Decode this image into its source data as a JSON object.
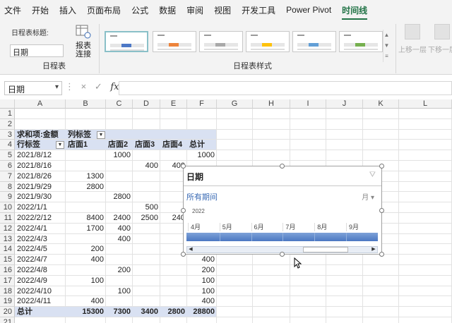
{
  "menubar": {
    "items": [
      "文件",
      "开始",
      "插入",
      "页面布局",
      "公式",
      "数据",
      "审阅",
      "视图",
      "开发工具",
      "Power Pivot",
      "时间线"
    ]
  },
  "ribbon": {
    "caption_label": "日程表标题:",
    "caption_value": "日期",
    "report_btn": "报表连接",
    "report_btn_l1": "报表",
    "report_btn_l2": "连接",
    "group1": "日程表",
    "group2": "日程表样式",
    "bring_forward": "上移一层",
    "send_backward": "下移一层"
  },
  "ribbon_styles": [
    "#4472c4",
    "#ed7d31",
    "#a5a5a5",
    "#ffc000",
    "#5b9bd5",
    "#70ad47"
  ],
  "formula": {
    "namebox": "日期",
    "fx": "fx",
    "cancel": "×",
    "enter": "✓"
  },
  "columns": [
    "A",
    "B",
    "C",
    "D",
    "E",
    "F",
    "G",
    "H",
    "I",
    "J",
    "K",
    "L"
  ],
  "rows": [
    "1",
    "2",
    "3",
    "4",
    "5",
    "6",
    "7",
    "8",
    "9",
    "10",
    "11",
    "12",
    "13",
    "14",
    "15",
    "16",
    "17",
    "18",
    "19",
    "20",
    "21"
  ],
  "pivot": {
    "sum_label": "求和项:金额",
    "col_label": "列标签",
    "row_label": "行标签",
    "headers": [
      "店面1",
      "店面2",
      "店面3",
      "店面4",
      "总计"
    ],
    "rows": [
      {
        "label": "2021/8/12",
        "v": [
          "",
          "1000",
          "",
          "",
          "1000"
        ]
      },
      {
        "label": "2021/8/16",
        "v": [
          "",
          "",
          "400",
          "400",
          ""
        ]
      },
      {
        "label": "2021/8/26",
        "v": [
          "1300",
          "",
          "",
          "",
          ""
        ]
      },
      {
        "label": "2021/9/29",
        "v": [
          "2800",
          "",
          "",
          "",
          ""
        ]
      },
      {
        "label": "2021/9/30",
        "v": [
          "",
          "2800",
          "",
          "",
          ""
        ]
      },
      {
        "label": "2022/1/1",
        "v": [
          "",
          "",
          "500",
          "",
          ""
        ]
      },
      {
        "label": "2022/2/12",
        "v": [
          "8400",
          "2400",
          "2500",
          "240",
          ""
        ]
      },
      {
        "label": "2022/4/1",
        "v": [
          "1700",
          "400",
          "",
          "",
          ""
        ]
      },
      {
        "label": "2022/4/3",
        "v": [
          "",
          "400",
          "",
          "",
          ""
        ]
      },
      {
        "label": "2022/4/5",
        "v": [
          "200",
          "",
          "",
          "",
          ""
        ]
      },
      {
        "label": "2022/4/7",
        "v": [
          "400",
          "",
          "",
          "",
          "400"
        ]
      },
      {
        "label": "2022/4/8",
        "v": [
          "",
          "200",
          "",
          "",
          "200"
        ]
      },
      {
        "label": "2022/4/9",
        "v": [
          "100",
          "",
          "",
          "",
          "100"
        ]
      },
      {
        "label": "2022/4/10",
        "v": [
          "",
          "100",
          "",
          "",
          "100"
        ]
      },
      {
        "label": "2022/4/11",
        "v": [
          "400",
          "",
          "",
          "",
          "400"
        ]
      }
    ],
    "total_label": "总计",
    "totals": [
      "15300",
      "7300",
      "3400",
      "2800",
      "28800"
    ]
  },
  "slicer": {
    "title": "日期",
    "period": "所有期间",
    "level": "月 ▾",
    "year": "2022",
    "months": [
      "4月",
      "5月",
      "6月",
      "7月",
      "8月",
      "9月"
    ]
  }
}
